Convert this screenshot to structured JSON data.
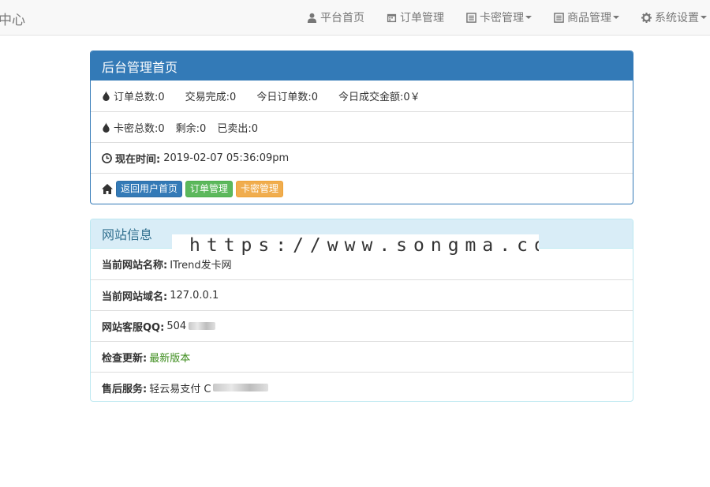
{
  "navbar": {
    "brand": "中心",
    "items": [
      {
        "label": "平台首页",
        "icon": "user-icon"
      },
      {
        "label": "订单管理",
        "icon": "calendar-icon"
      },
      {
        "label": "卡密管理",
        "icon": "list-icon",
        "dropdown": true
      },
      {
        "label": "商品管理",
        "icon": "list-icon",
        "dropdown": true
      },
      {
        "label": "系统设置",
        "icon": "gear-icon",
        "dropdown": true
      }
    ]
  },
  "dashboard": {
    "title": "后台管理首页",
    "orders": {
      "total": "订单总数:0",
      "completed": "交易完成:0",
      "today_orders": "今日订单数:0",
      "today_amount": "今日成交金额:0￥"
    },
    "cards": {
      "total": "卡密总数:0",
      "remaining": "剩余:0",
      "sold": "已卖出:0"
    },
    "time": {
      "label": "现在时间:",
      "value": "2019-02-07 05:36:09pm"
    },
    "buttons": {
      "home": "返回用户首页",
      "orders": "订单管理",
      "cards": "卡密管理"
    }
  },
  "site_info": {
    "title": "网站信息",
    "name_label": "当前网站名称:",
    "name_value": "ITrend发卡网",
    "domain_label": "当前网站域名:",
    "domain_value": "127.0.0.1",
    "qq_label": "网站客服QQ:",
    "qq_value": "504",
    "update_label": "检查更新:",
    "update_value": "最新版本",
    "service_label": "售后服务:",
    "service_value": "轻云易支付 C"
  },
  "watermark": "https://www.songma.com",
  "colors": {
    "primary": "#337ab7",
    "success": "#5cb85c",
    "warning": "#f0ad4e",
    "info_bg": "#d9edf7",
    "info_text": "#31708f"
  }
}
